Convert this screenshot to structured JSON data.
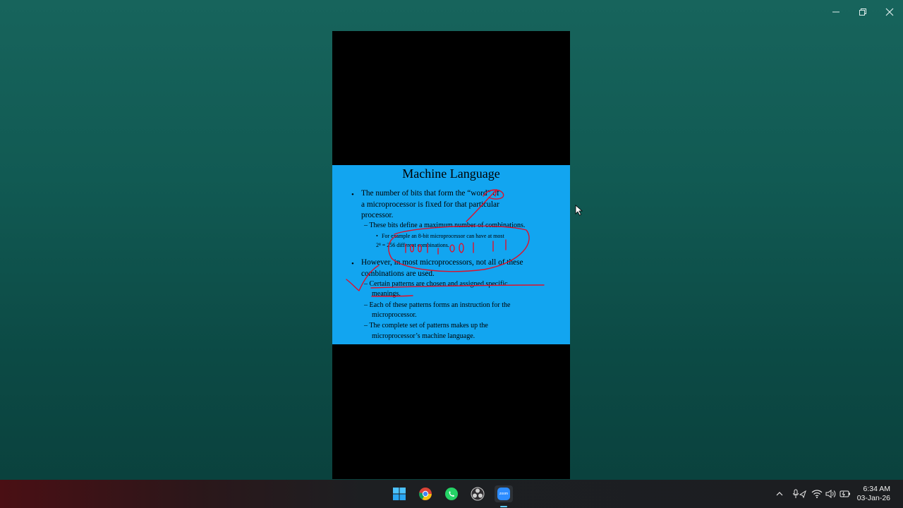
{
  "window": {
    "controls": [
      "minimize-icon",
      "restore-icon",
      "close-icon"
    ]
  },
  "slide": {
    "title": "Machine Language",
    "bullet1": {
      "line1": "The number of bits that form the “word” of",
      "line2": "a microprocessor is fixed for that particular",
      "line3": "processor.",
      "sub1": "– These bits define a maximum number of combinations.",
      "subsub1_line1": "For example an 8-bit microprocessor can have at most",
      "subsub1_line2": "2⁸ = 256 different combinations."
    },
    "bullet2": {
      "line1": "However, in most microprocessors, not all of these",
      "line2": "combinations are used.",
      "sub1_line1": "– Certain patterns are chosen and assigned specific",
      "sub1_line2": "meanings.",
      "sub2_line1": "– Each of these patterns forms an instruction for the",
      "sub2_line2": "microprocessor.",
      "sub3_line1": "– The complete set of patterns makes up the",
      "sub3_line2": "microprocessor’s machine language."
    },
    "annotation_color": "#e0102a",
    "background_color": "#12a5f0"
  },
  "taskbar": {
    "apps": [
      "windows-start-icon",
      "chrome-icon",
      "whatsapp-icon",
      "obs-icon",
      "zoom-icon"
    ],
    "active_app": "zoom-icon",
    "zoom_label": "zoom",
    "tray": [
      "chevron-up-icon",
      "mic-icon",
      "wifi-icon",
      "volume-icon",
      "battery-icon"
    ],
    "time": "6:34 AM",
    "date": "03-Jan-26"
  }
}
